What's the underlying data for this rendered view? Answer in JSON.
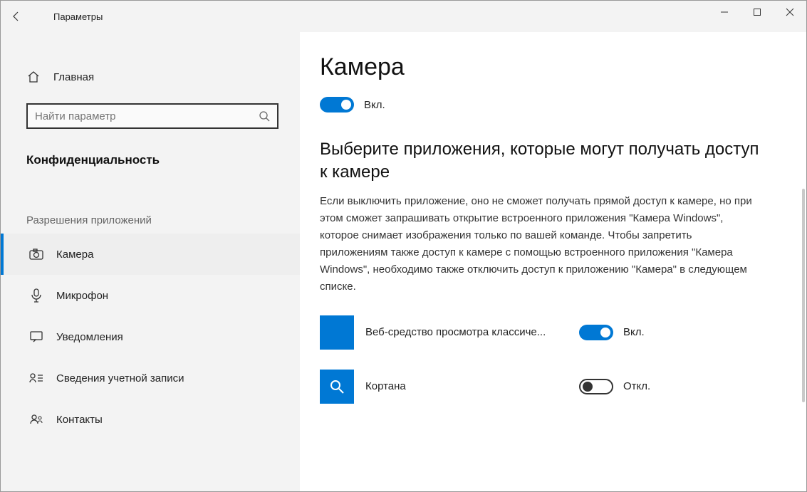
{
  "titlebar": {
    "title": "Параметры"
  },
  "sidebar": {
    "home": "Главная",
    "search_placeholder": "Найти параметр",
    "category": "Конфиденциальность",
    "section_label": "Разрешения приложений",
    "items": [
      {
        "label": "Камера",
        "active": true
      },
      {
        "label": "Микрофон"
      },
      {
        "label": "Уведомления"
      },
      {
        "label": "Сведения учетной записи"
      },
      {
        "label": "Контакты"
      }
    ]
  },
  "main": {
    "heading": "Камера",
    "master_toggle": {
      "state": "on",
      "label": "Вкл."
    },
    "subheading": "Выберите приложения, которые могут получать доступ к камере",
    "description": "Если выключить приложение, оно не сможет получать прямой доступ к камере, но при этом сможет запрашивать открытие встроенного приложения \"Камера Windows\", которое снимает изображения только по вашей команде. Чтобы запретить приложениям также доступ к камере с помощью встроенного приложения \"Камера Windows\", необходимо также отключить доступ к приложению \"Камера\" в следующем списке.",
    "apps": [
      {
        "name": "Веб-средство просмотра классиче...",
        "state": "on",
        "state_label": "Вкл.",
        "icon": "blank"
      },
      {
        "name": "Кортана",
        "state": "off",
        "state_label": "Откл.",
        "icon": "search"
      }
    ]
  }
}
